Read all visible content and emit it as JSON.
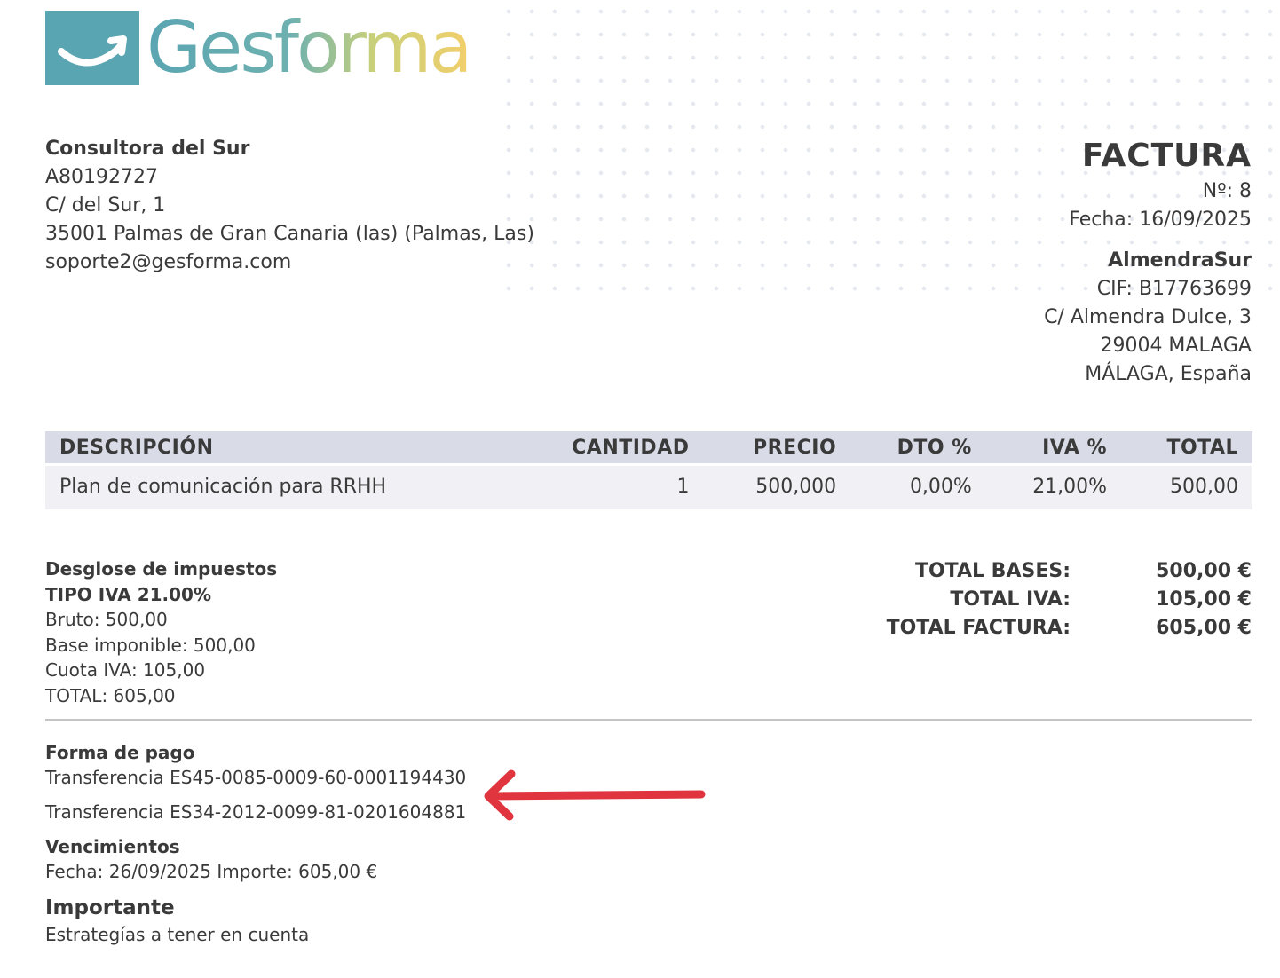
{
  "logo": {
    "text": "Gesforma",
    "colors": {
      "teal": "#5aa5b2",
      "yellow": "#f2cf6b"
    }
  },
  "issuer": {
    "name": "Consultora del Sur",
    "tax_id": "A80192727",
    "address_line1": "C/ del Sur, 1",
    "address_line2": "35001 Palmas de Gran Canaria (las) (Palmas, Las)",
    "email": "soporte2@gesforma.com"
  },
  "invoice": {
    "title": "FACTURA",
    "number": "Nº: 8",
    "date": "Fecha: 16/09/2025"
  },
  "client": {
    "name": "AlmendraSur",
    "cif": "CIF: B17763699",
    "address_line1": "C/ Almendra Dulce, 3",
    "address_line2": "29004 MALAGA",
    "address_line3": "MÁLAGA, España"
  },
  "items_table": {
    "headers": {
      "description": "DESCRIPCIÓN",
      "quantity": "CANTIDAD",
      "price": "PRECIO",
      "discount": "DTO %",
      "vat": "IVA %",
      "total": "TOTAL"
    },
    "rows": [
      {
        "description": "Plan de comunicación para RRHH",
        "quantity": "1",
        "price": "500,000",
        "discount": "0,00%",
        "vat": "21,00%",
        "total": "500,00"
      }
    ]
  },
  "tax_breakdown": {
    "title": "Desglose de impuestos",
    "type": "TIPO IVA 21.00%",
    "gross": "Bruto: 500,00",
    "taxable_base": "Base imponible: 500,00",
    "vat_amount": "Cuota IVA: 105,00",
    "total": "TOTAL: 605,00"
  },
  "totals": {
    "bases_label": "TOTAL BASES:",
    "bases_value": "500,00 €",
    "vat_label": "TOTAL IVA:",
    "vat_value": "105,00 €",
    "invoice_label": "TOTAL FACTURA:",
    "invoice_value": "605,00 €"
  },
  "payment": {
    "title": "Forma de pago",
    "transfer1": "Transferencia ES45-0085-0009-60-0001194430",
    "transfer2": "Transferencia ES34-2012-0099-81-0201604881"
  },
  "due_dates": {
    "title": "Vencimientos",
    "line": "Fecha: 26/09/2025 Importe: 605,00 €"
  },
  "important": {
    "title": "Importante",
    "text": "Estrategías a tener en cuenta"
  },
  "annotation": {
    "arrow_color": "#e0343f"
  }
}
